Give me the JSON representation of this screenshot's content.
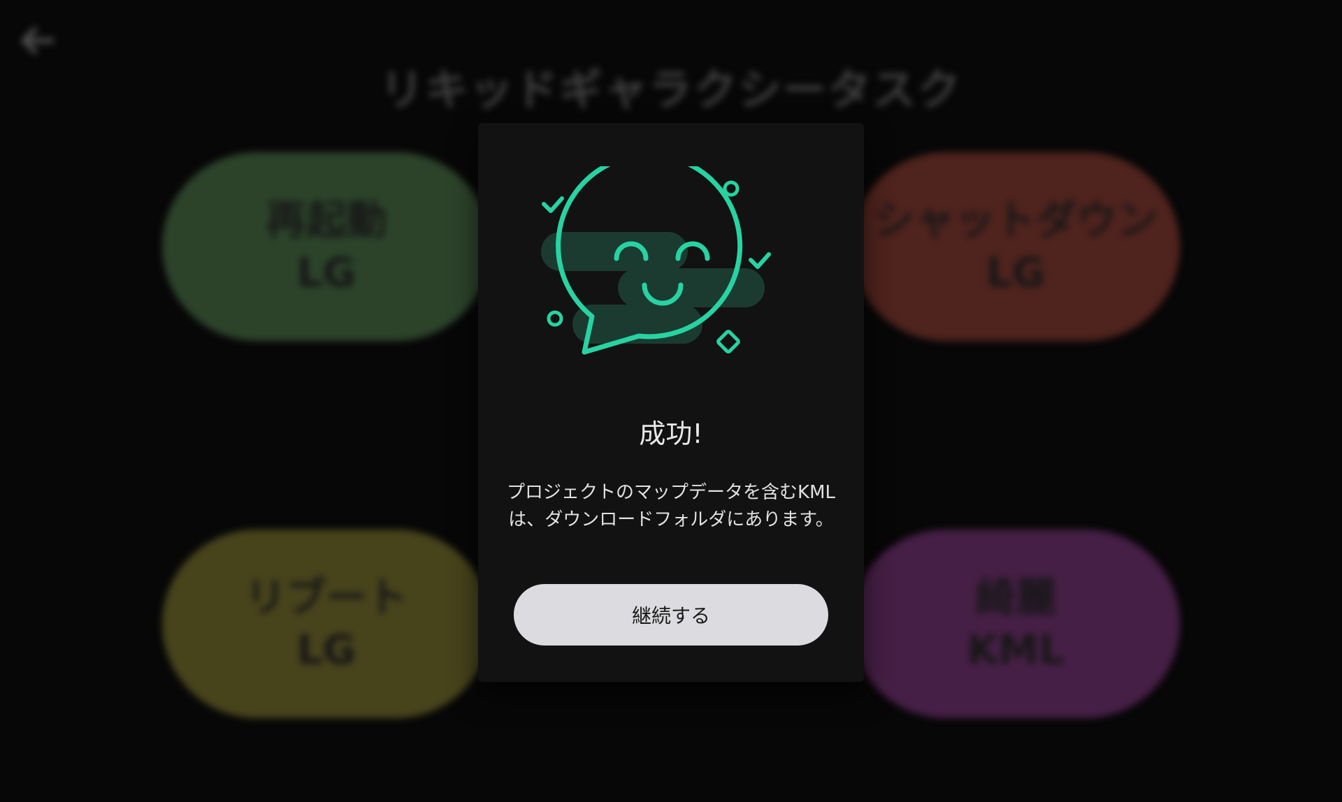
{
  "app": {
    "title": "リキッドギャラクシータスク"
  },
  "header": {
    "back_icon": "arrow-left-icon"
  },
  "tasks": [
    {
      "line1": "再起動",
      "line2": "LG",
      "color": "#3b5a39"
    },
    {
      "line1": "シャットダウン",
      "line2": "LG",
      "color": "#6a2f28"
    },
    {
      "line1": "リブート",
      "line2": "LG",
      "color": "#5f5a25"
    },
    {
      "line1": "綺麗",
      "line2": "KML",
      "color": "#5d2a5d"
    }
  ],
  "dialog": {
    "title": "成功!",
    "message": "プロジェクトのマップデータを含むKMLは、ダウンロードフォルダにあります。",
    "button_label": "継続する",
    "accent_color": "#27d3a2",
    "illustration_icon": "smiling-chat-bubble-icon"
  }
}
